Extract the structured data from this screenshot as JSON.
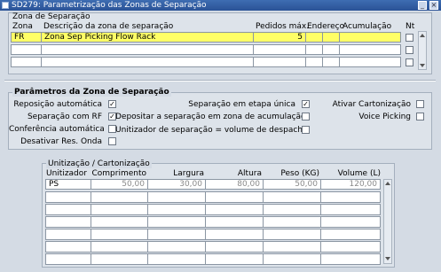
{
  "window": {
    "title": "SD279: Parametrização das Zonas de Separação"
  },
  "zones": {
    "title": "Zona de Separação",
    "columns": {
      "zona": "Zona",
      "descricao": "Descrição da zona de separação",
      "pedidos": "Pedidos máx.",
      "endereco": "Endereço",
      "acumulacao": "Acumulação",
      "nt": "Nt"
    },
    "rows": [
      {
        "zona": "FR",
        "descricao": "Zona Sep Picking Flow Rack",
        "pedidos": "5",
        "endereco": "",
        "acumulacao": "",
        "nt": false
      },
      {
        "zona": "",
        "descricao": "",
        "pedidos": "",
        "endereco": "",
        "acumulacao": "",
        "nt": false
      },
      {
        "zona": "",
        "descricao": "",
        "pedidos": "",
        "endereco": "",
        "acumulacao": "",
        "nt": false
      }
    ]
  },
  "params": {
    "title": "Parâmetros da Zona de Separação",
    "reposicao": {
      "label": "Reposição automática",
      "checked": true
    },
    "sep_rf": {
      "label": "Separação com RF",
      "checked": true
    },
    "conferencia": {
      "label": "Conferência automática",
      "checked": false
    },
    "desativar": {
      "label": "Desativar Res. Onda",
      "checked": false
    },
    "etapa": {
      "label": "Separação em etapa única",
      "checked": true
    },
    "depositar": {
      "label": "Depositar a separação em zona de acumulação",
      "checked": false
    },
    "unitizador": {
      "label": "Unitizador de separação = volume de despacho",
      "checked": false
    },
    "cartonizacao": {
      "label": "Ativar Cartonização",
      "checked": false
    },
    "voice": {
      "label": "Voice Picking",
      "checked": false
    }
  },
  "unit": {
    "title": "Unitização / Cartonização",
    "columns": {
      "unitizador": "Unitizador",
      "comprimento": "Comprimento",
      "largura": "Largura",
      "altura": "Altura",
      "peso": "Peso (KG)",
      "volume": "Volume (L)"
    },
    "rows": [
      {
        "unitizador": "PS",
        "comprimento": "50,00",
        "largura": "30,00",
        "altura": "80,00",
        "peso": "50,00",
        "volume": "120,00"
      }
    ]
  },
  "icons": {
    "app": "app-icon",
    "close": "close-icon",
    "scroll_up": "arrow-up-icon",
    "scroll_down": "arrow-down-icon"
  },
  "colors": {
    "titlebar": "#2a5296",
    "selected_row": "#ffff66",
    "background": "#d4dbe4"
  }
}
